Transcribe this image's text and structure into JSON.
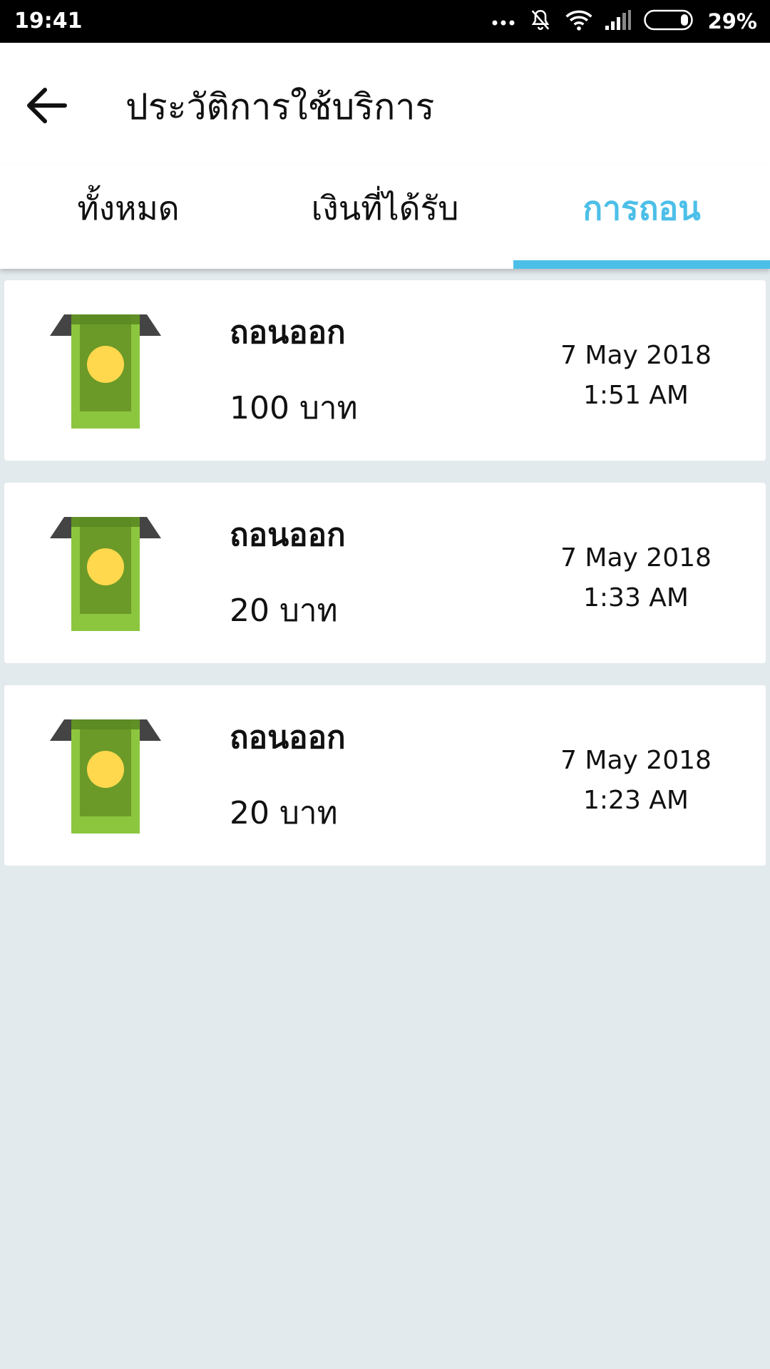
{
  "status_bar": {
    "time": "19:41",
    "battery": "29%",
    "icons": [
      "more-dots-icon",
      "bell-off-icon",
      "wifi-icon",
      "signal-icon",
      "battery-icon"
    ]
  },
  "app_bar": {
    "title": "ประวัติการใช้บริการ",
    "back_icon": "arrow-left-icon"
  },
  "tabs": [
    {
      "label": "ทั้งหมด",
      "active": false
    },
    {
      "label": "เงินที่ได้รับ",
      "active": false
    },
    {
      "label": "การถอน",
      "active": true
    }
  ],
  "colors": {
    "accent": "#4cbfe8",
    "background": "#e3eaed",
    "money_green": "#8cc63f",
    "money_dark": "#6b9a28",
    "coin": "#ffd84d",
    "slot": "#444444"
  },
  "transactions": [
    {
      "icon": "cash-withdraw-icon",
      "title": "ถอนออก",
      "amount": "100 บาท",
      "date": "7 May 2018",
      "time": "1:51 AM"
    },
    {
      "icon": "cash-withdraw-icon",
      "title": "ถอนออก",
      "amount": "20 บาท",
      "date": "7 May 2018",
      "time": "1:33 AM"
    },
    {
      "icon": "cash-withdraw-icon",
      "title": "ถอนออก",
      "amount": "20 บาท",
      "date": "7 May 2018",
      "time": "1:23 AM"
    }
  ]
}
